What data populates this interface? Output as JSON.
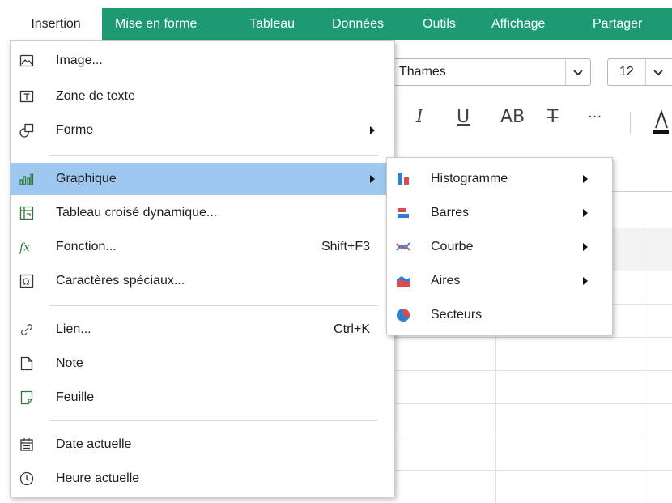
{
  "menubar": {
    "items": [
      "Insertion",
      "Mise en forme",
      "Tableau",
      "Données",
      "Outils",
      "Affichage",
      "Partager"
    ],
    "accent": "#1e9a73"
  },
  "toolbar": {
    "font_value": "Thames",
    "size_value": "12",
    "italic": "I",
    "underline": "U",
    "caps": "AB",
    "strike": "T",
    "more": "···"
  },
  "menu": {
    "items": [
      {
        "label": "Image...",
        "icon": "image-icon"
      },
      {
        "label": "Zone de texte",
        "icon": "text-box-icon"
      },
      {
        "label": "Forme",
        "icon": "shape-icon"
      },
      {
        "label": "Graphique",
        "icon": "chart-icon"
      },
      {
        "label": "Tableau croisé dynamique...",
        "icon": "pivot-table-icon"
      },
      {
        "label": "Fonction...",
        "icon": "function-icon",
        "shortcut": "Shift+F3"
      },
      {
        "label": "Caractères spéciaux...",
        "icon": "special-chars-icon"
      },
      {
        "label": "Lien...",
        "icon": "link-icon",
        "shortcut": "Ctrl+K"
      },
      {
        "label": "Note",
        "icon": "note-icon"
      },
      {
        "label": "Feuille",
        "icon": "sheet-icon"
      },
      {
        "label": "Date actuelle",
        "icon": "calendar-icon"
      },
      {
        "label": "Heure actuelle",
        "icon": "clock-icon"
      }
    ],
    "highlight": "#9ec8ef"
  },
  "submenu": {
    "items": [
      {
        "label": "Histogramme",
        "icon": "column-chart-icon"
      },
      {
        "label": "Barres",
        "icon": "bar-chart-icon"
      },
      {
        "label": "Courbe",
        "icon": "line-chart-icon"
      },
      {
        "label": "Aires",
        "icon": "area-chart-icon"
      },
      {
        "label": "Secteurs",
        "icon": "pie-chart-icon"
      }
    ]
  }
}
